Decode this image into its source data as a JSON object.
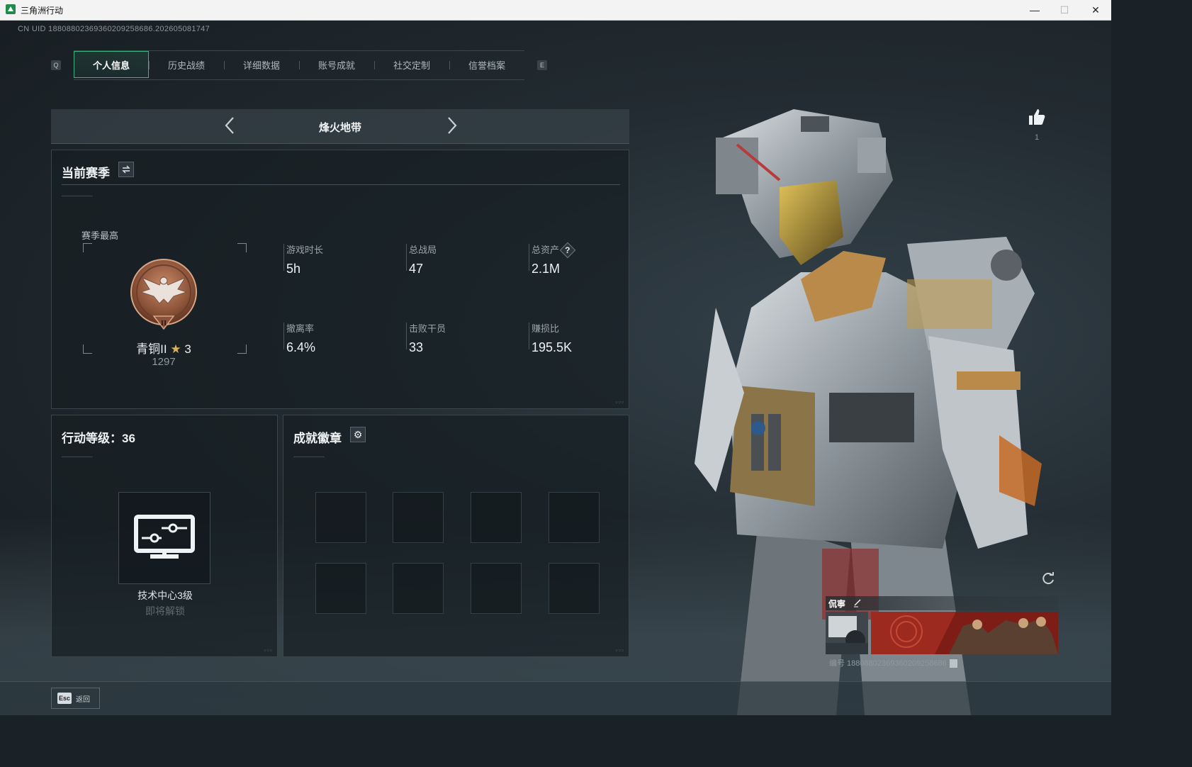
{
  "window": {
    "title": "三角洲行动",
    "min_glyph": "—",
    "max_glyph": "☐",
    "close_glyph": "✕"
  },
  "uid_line": "CN UID 18808802369360209258686.202605081747",
  "keys": {
    "prev_tab": "Q",
    "next_tab": "E"
  },
  "tabs": [
    {
      "label": "个人信息",
      "active": true
    },
    {
      "label": "历史战绩",
      "active": false
    },
    {
      "label": "详细数据",
      "active": false
    },
    {
      "label": "账号成就",
      "active": false
    },
    {
      "label": "社交定制",
      "active": false
    },
    {
      "label": "信誉档案",
      "active": false
    }
  ],
  "mode": {
    "label": "烽火地带"
  },
  "season": {
    "title": "当前赛季",
    "best_label": "赛季最高",
    "rank_name": "青铜II",
    "rank_stars": "3",
    "rank_star_glyph": "★",
    "rank_score": "1297",
    "rank_numeral": "II",
    "stats": [
      {
        "label": "游戏时长",
        "value": "5h"
      },
      {
        "label": "总战局",
        "value": "47"
      },
      {
        "label": "总资产",
        "value": "2.1M",
        "help": "?"
      },
      {
        "label": "撤离率",
        "value": "6.4%"
      },
      {
        "label": "击败干员",
        "value": "33"
      },
      {
        "label": "赚损比",
        "value": "195.5K"
      }
    ]
  },
  "level": {
    "title": "行动等级：36",
    "unlock_name": "技术中心3级",
    "unlock_status": "即将解锁"
  },
  "badges": {
    "title": "成就徽章"
  },
  "likes": {
    "count": "1"
  },
  "card": {
    "name": "侃寧",
    "id_line": "编号 18808802369360209258686"
  },
  "footer": {
    "esc_key": "Esc",
    "back_label": "返回"
  },
  "colors": {
    "accent": "#39b57e",
    "rank_bronze": "#a0674c",
    "star_gold": "#d9b25a"
  }
}
